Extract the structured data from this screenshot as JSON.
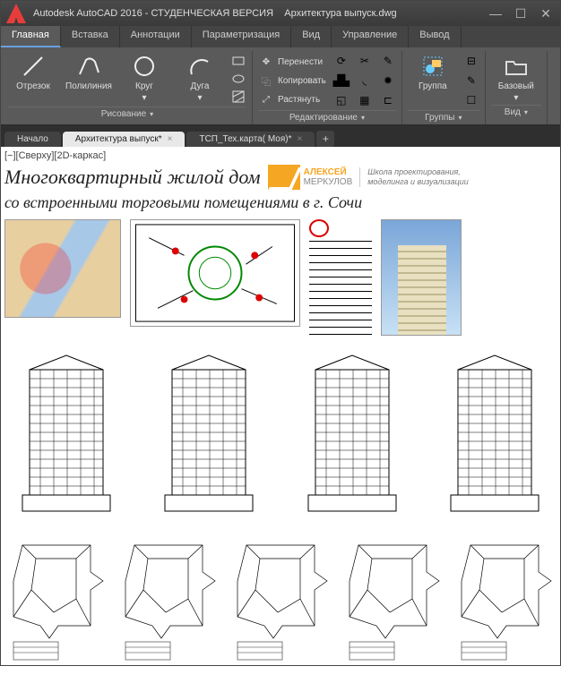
{
  "titlebar": {
    "app": "Autodesk AutoCAD 2016 - СТУДЕНЧЕСКАЯ ВЕРСИЯ",
    "file": "Архитектура выпуск.dwg"
  },
  "menu": {
    "tabs": [
      "Главная",
      "Вставка",
      "Аннотации",
      "Параметризация",
      "Вид",
      "Управление",
      "Вывод"
    ]
  },
  "ribbon": {
    "draw": {
      "line": "Отрезок",
      "pline": "Полилиния",
      "circle": "Круг",
      "arc": "Дуга",
      "panel": "Рисование"
    },
    "modify": {
      "move": "Перенести",
      "copy": "Копировать",
      "stretch": "Растянуть",
      "panel": "Редактирование"
    },
    "group": {
      "btn": "Группа",
      "panel": "Группы"
    },
    "view": {
      "btn": "Базовый",
      "panel": "Вид"
    }
  },
  "tabs": {
    "t0": "Начало",
    "t1": "Архитектура выпуск*",
    "t2": "ТСП_Тех.карта( Моя)*"
  },
  "canvas": {
    "viewlabel": "[−][Сверху][2D-каркас]",
    "title": "Многоквартирный жилой дом",
    "brand1": "АЛЕКСЕЙ",
    "brand2": "МЕРКУЛОВ",
    "school1": "Школа проектирования,",
    "school2": "моделинга и визуализации",
    "subtitle": "со встроенными торговыми помещениями в г. Сочи"
  }
}
